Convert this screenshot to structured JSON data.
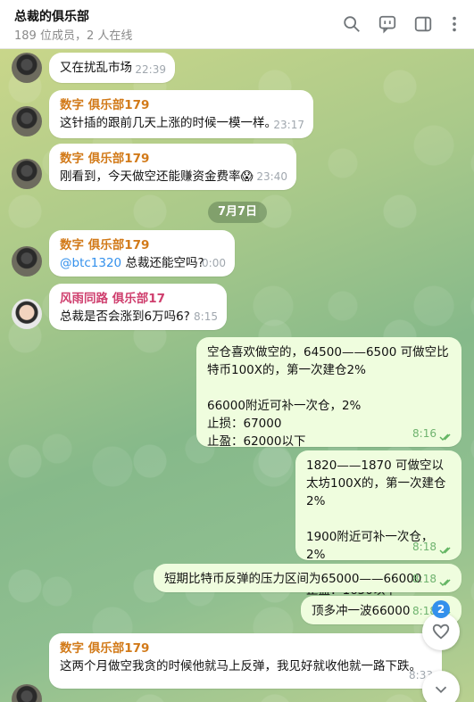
{
  "header": {
    "title": "总裁的俱乐部",
    "subtitle": "189 位成员，2 人在线"
  },
  "date_separator": "7月7日",
  "messages": [
    {
      "text": "又在扰乱市场",
      "time": "22:39"
    },
    {
      "sender": "数字 俱乐部179",
      "sender_color": "#d27a19",
      "text": "这针插的跟前几天上涨的时候一模一样。",
      "time": "23:17"
    },
    {
      "sender": "数字 俱乐部179",
      "sender_color": "#d27a19",
      "text": "刚看到，今天做空还能赚资金费率😱",
      "time": "23:40"
    },
    {
      "sender": "数字 俱乐部179",
      "sender_color": "#d27a19",
      "mention": "@btc1320",
      "text": " 总裁还能空吗?",
      "time": "0:00"
    },
    {
      "sender": "风雨同路 俱乐部17",
      "sender_color": "#cf3f6e",
      "text": "总裁是否会涨到6万吗6?",
      "time": "8:15"
    },
    {
      "text": "空仓喜欢做空的，64500——6500 可做空比特币100X的，第一次建仓2%\n\n66000附近可补一次仓，2%\n止损：67000\n止盈：62000以下",
      "time": "8:16"
    },
    {
      "text": "1820——1870 可做空以太坊100X的，第一次建仓2%\n\n1900附近可补一次仓，2%\n止损：1950\n止盈：1650以下",
      "time": "8:18"
    },
    {
      "text": "短期比特币反弹的压力区间为65000——66000",
      "time": "8:18"
    },
    {
      "text": "顶多冲一波66000",
      "time": "8:18"
    },
    {
      "sender": "数字 俱乐部179",
      "sender_color": "#d27a19",
      "text": "这两个月做空我贪的时候他就马上反弹，我见好就收他就一路下跌。",
      "time": "8:33"
    }
  ],
  "reactions_badge": "2",
  "icons": {
    "search": "search-icon",
    "chat": "comments-icon",
    "panel": "sidebar-toggle-icon",
    "more": "more-vertical-icon",
    "heart": "heart-icon",
    "scroll_down": "chevron-down-icon"
  }
}
